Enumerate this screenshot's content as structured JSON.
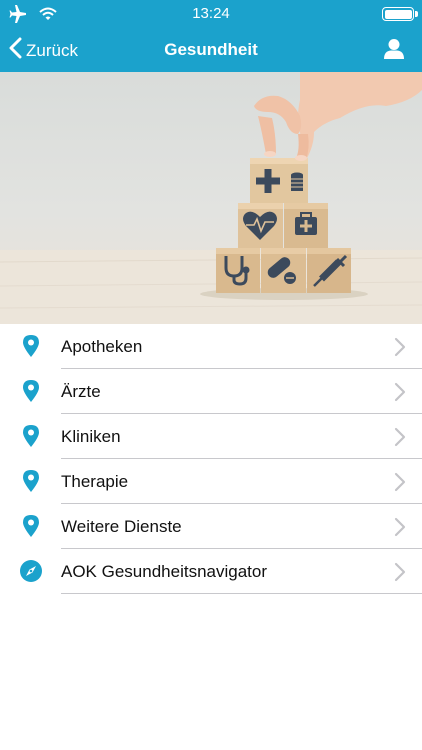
{
  "status_bar": {
    "time": "13:24",
    "icons": [
      "airplane-icon",
      "wifi-icon",
      "battery-icon"
    ]
  },
  "nav": {
    "back_label": "Zurück",
    "title": "Gesundheit",
    "profile_icon": "user-icon"
  },
  "hero": {
    "description_icons": [
      "plus-icon",
      "coins-icon",
      "heartbeat-icon",
      "first-aid-kit-icon",
      "stethoscope-icon",
      "pills-icon",
      "syringe-icon"
    ]
  },
  "menu": {
    "items": [
      {
        "label": "Apotheken",
        "icon": "map-pin-icon"
      },
      {
        "label": "Ärzte",
        "icon": "map-pin-icon"
      },
      {
        "label": "Kliniken",
        "icon": "map-pin-icon"
      },
      {
        "label": "Therapie",
        "icon": "map-pin-icon"
      },
      {
        "label": "Weitere Dienste",
        "icon": "map-pin-icon"
      },
      {
        "label": "AOK Gesundheitsnavigator",
        "icon": "compass-icon"
      }
    ]
  },
  "colors": {
    "accent": "#1ba2cc",
    "separator": "#c8c8cc",
    "chevron": "#c4c4c8",
    "cube_icon": "#3c4a5c"
  }
}
